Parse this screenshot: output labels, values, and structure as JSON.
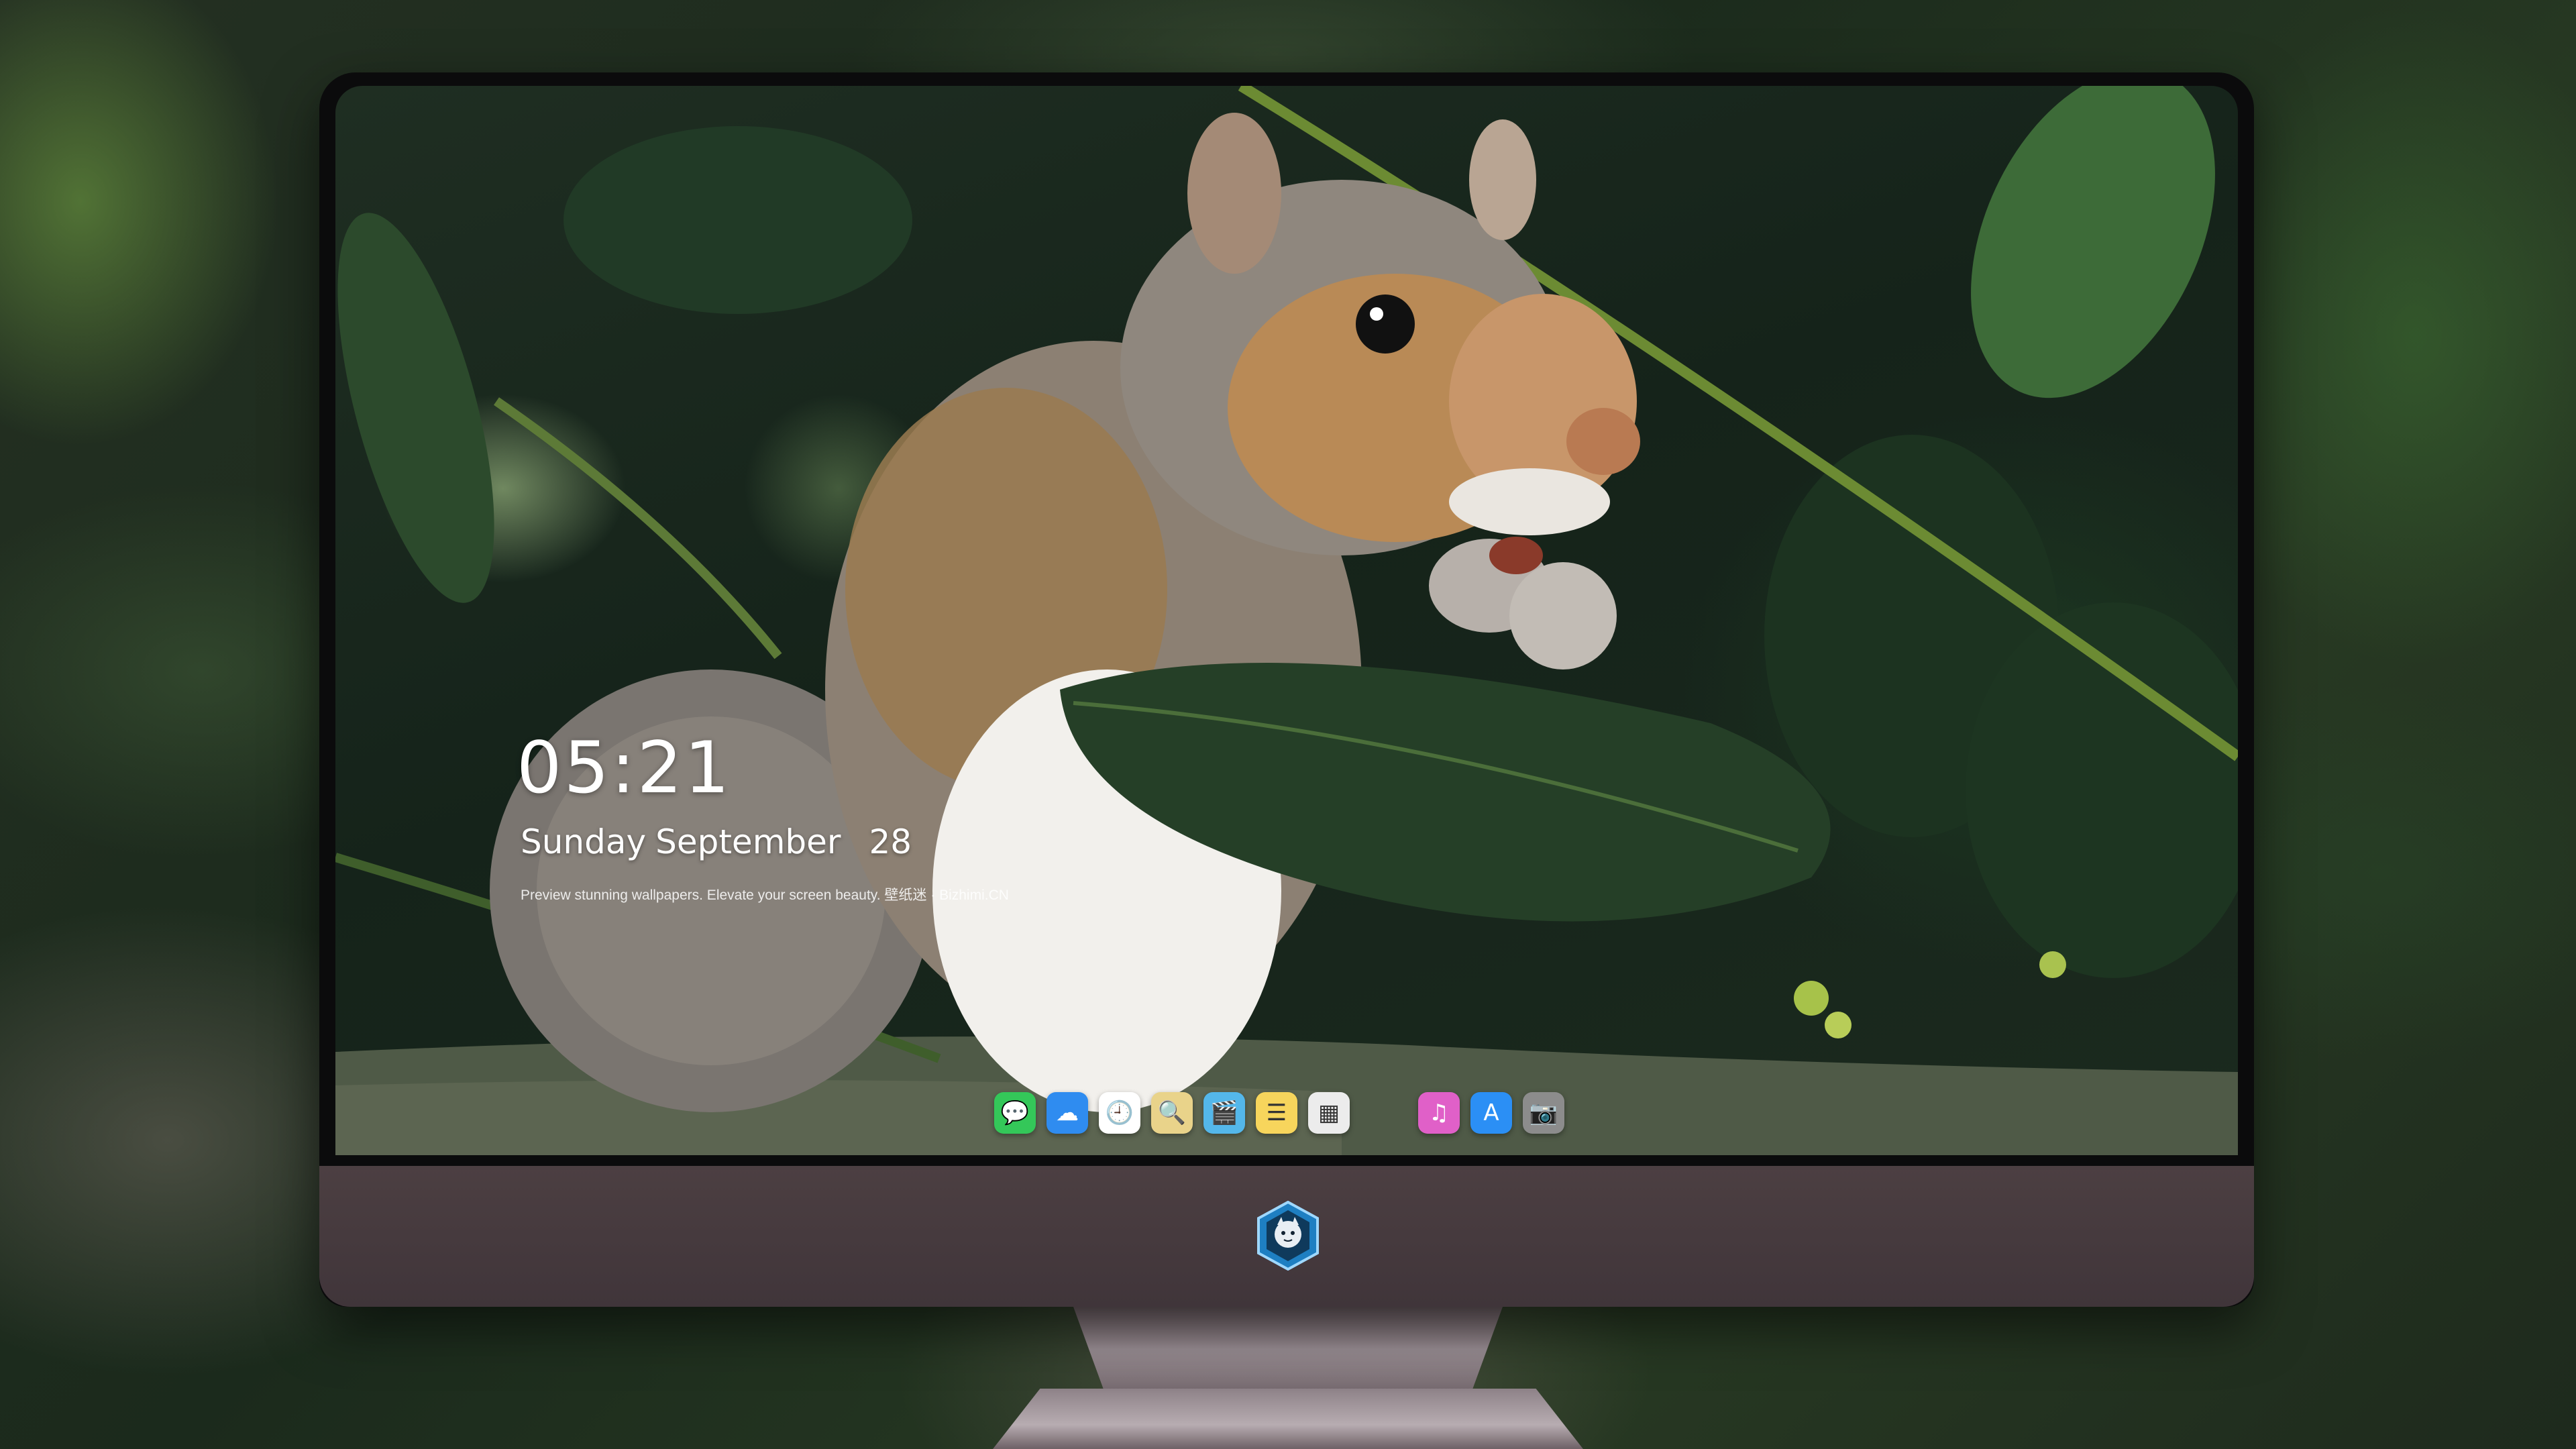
{
  "lock_screen": {
    "time": "05:21",
    "weekday": "Sunday",
    "month": "September",
    "day": "28",
    "tagline": "Preview stunning wallpapers. Elevate your screen beauty. 壁纸迷 · Bizhimi.CN"
  },
  "dock": {
    "apps": [
      {
        "name": "messages-icon",
        "glyph": "💬",
        "color": "#34c759"
      },
      {
        "name": "weather-icon",
        "glyph": "☁",
        "color": "#2f8cf0"
      },
      {
        "name": "clock-icon",
        "glyph": "🕘",
        "color": "#ffffff"
      },
      {
        "name": "preview-icon",
        "glyph": "🔍",
        "color": "#e9d38a"
      },
      {
        "name": "clips-icon",
        "glyph": "🎬",
        "color": "#54b7ea"
      },
      {
        "name": "notes-icon",
        "glyph": "☰",
        "color": "#f7d55c"
      },
      {
        "name": "photo-booth-icon",
        "glyph": "▦",
        "color": "#ececec"
      },
      {
        "name": "itunes-icon",
        "glyph": "♫",
        "color": "#e060c8"
      },
      {
        "name": "app-store-icon",
        "glyph": "A",
        "color": "#2b8ff5"
      },
      {
        "name": "camera-icon",
        "glyph": "📷",
        "color": "#8c8c8c"
      }
    ]
  },
  "colors": {
    "chin": "#45393e",
    "bezel": "#0b0b0c"
  }
}
